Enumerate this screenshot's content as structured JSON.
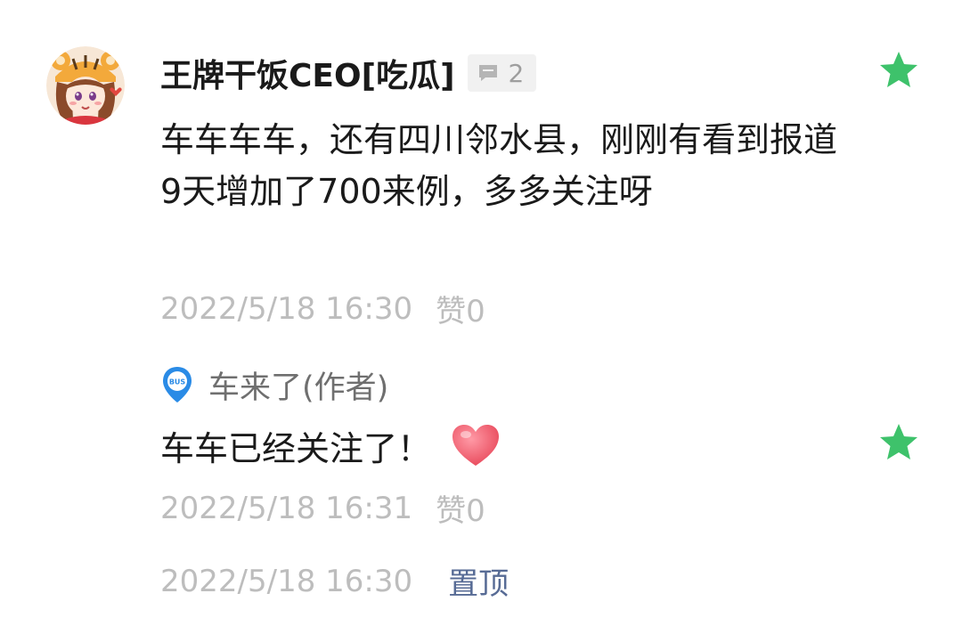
{
  "comment": {
    "username": "王牌干饭CEO[吃瓜]",
    "reply_count": "2",
    "text": "车车车车，还有四川邻水县，刚刚有看到报道9天增加了700来例，多多关注呀",
    "timestamp": "2022/5/18 16:30",
    "like_label": "赞0",
    "avatar_icon": "anime-girl-tiger-hat-avatar",
    "star_color": "#3ec26b"
  },
  "reply": {
    "author": "车来了(作者)",
    "author_icon": "bus-location-icon",
    "text": "车车已经关注了！",
    "emoji": "heart-icon",
    "timestamp": "2022/5/18 16:31",
    "like_label": "赞0"
  },
  "footer": {
    "timestamp": "2022/5/18 16:30",
    "pin_label": "置顶",
    "pin_color": "#576b95"
  },
  "colors": {
    "meta_gray": "#bdbdbd",
    "author_gray": "#6f6f6f",
    "badge_bg": "#f1f1f1"
  }
}
